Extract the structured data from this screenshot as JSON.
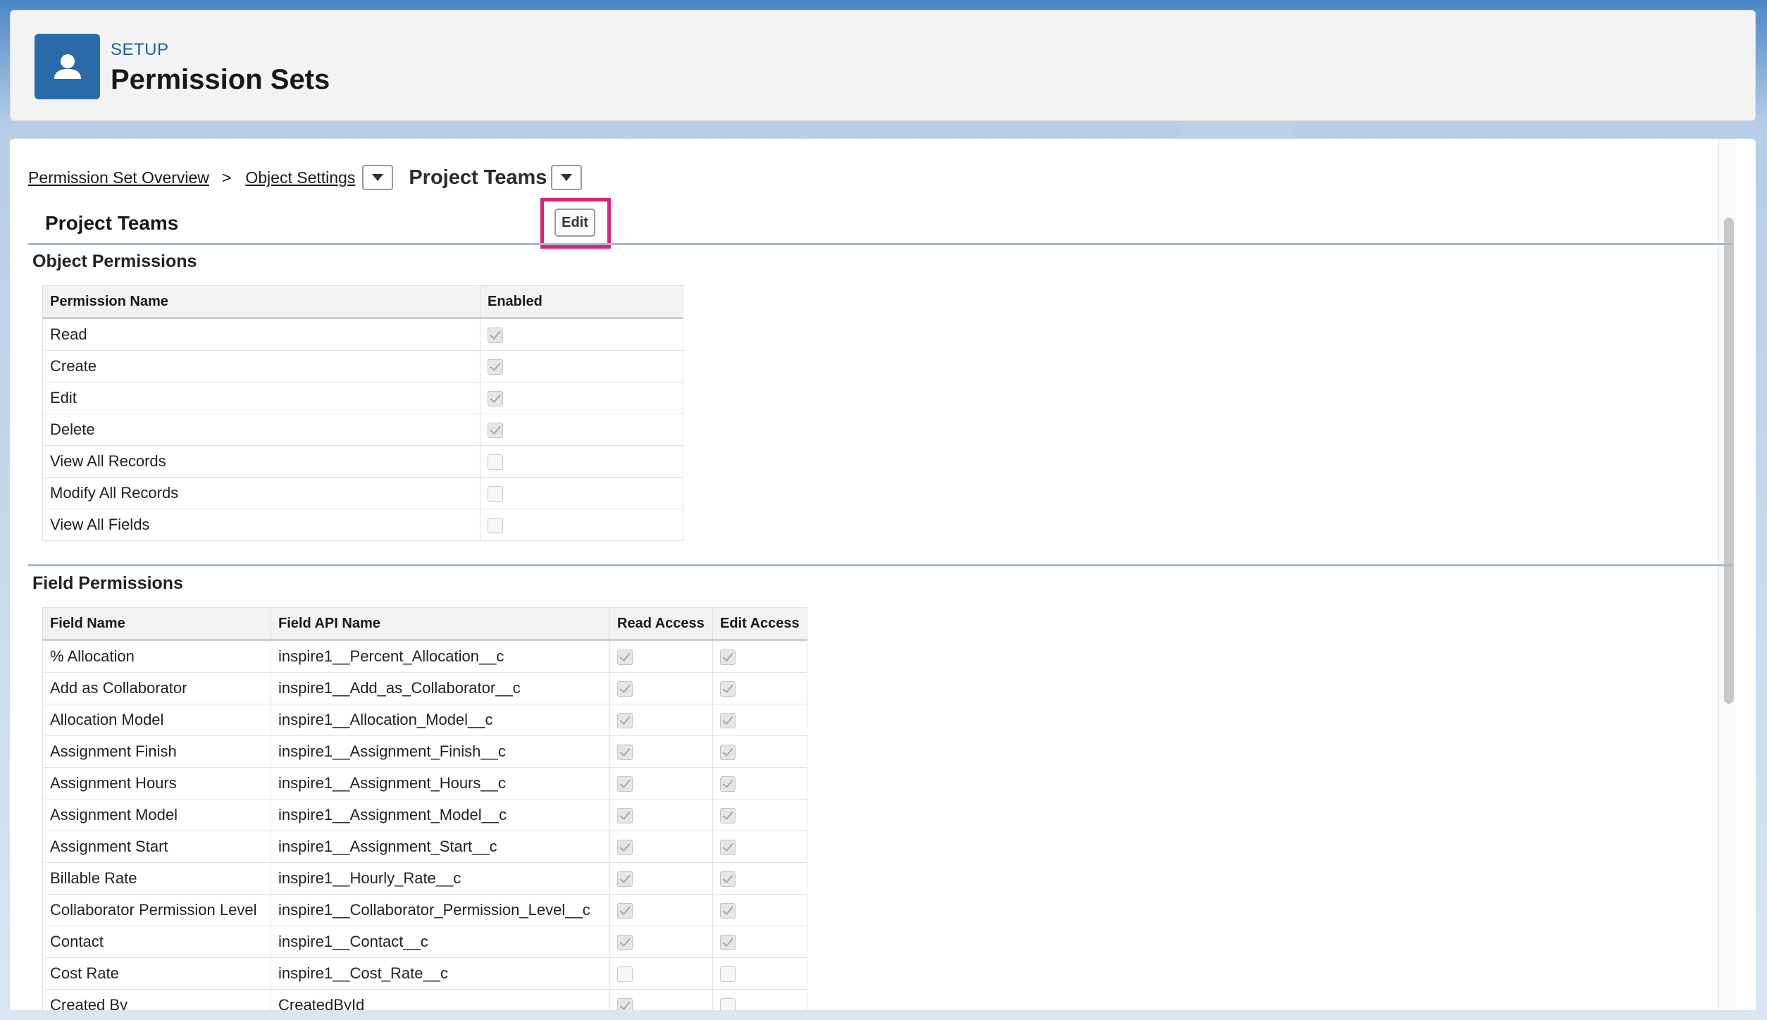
{
  "header": {
    "label": "SETUP",
    "title": "Permission Sets"
  },
  "breadcrumb": {
    "overview": "Permission Set Overview",
    "separator": ">",
    "object_settings": "Object Settings",
    "current": "Project Teams"
  },
  "section": {
    "title": "Project Teams",
    "edit_label": "Edit"
  },
  "object_permissions": {
    "title": "Object Permissions",
    "headers": [
      "Permission Name",
      "Enabled"
    ],
    "rows": [
      {
        "name": "Read",
        "enabled": true
      },
      {
        "name": "Create",
        "enabled": true
      },
      {
        "name": "Edit",
        "enabled": true
      },
      {
        "name": "Delete",
        "enabled": true
      },
      {
        "name": "View All Records",
        "enabled": false
      },
      {
        "name": "Modify All Records",
        "enabled": false
      },
      {
        "name": "View All Fields",
        "enabled": false
      }
    ]
  },
  "field_permissions": {
    "title": "Field Permissions",
    "headers": [
      "Field Name",
      "Field API Name",
      "Read Access",
      "Edit Access"
    ],
    "rows": [
      {
        "name": "% Allocation",
        "api": "inspire1__Percent_Allocation__c",
        "read": true,
        "edit": true
      },
      {
        "name": "Add as Collaborator",
        "api": "inspire1__Add_as_Collaborator__c",
        "read": true,
        "edit": true
      },
      {
        "name": "Allocation Model",
        "api": "inspire1__Allocation_Model__c",
        "read": true,
        "edit": true
      },
      {
        "name": "Assignment Finish",
        "api": "inspire1__Assignment_Finish__c",
        "read": true,
        "edit": true
      },
      {
        "name": "Assignment Hours",
        "api": "inspire1__Assignment_Hours__c",
        "read": true,
        "edit": true
      },
      {
        "name": "Assignment Model",
        "api": "inspire1__Assignment_Model__c",
        "read": true,
        "edit": true
      },
      {
        "name": "Assignment Start",
        "api": "inspire1__Assignment_Start__c",
        "read": true,
        "edit": true
      },
      {
        "name": "Billable Rate",
        "api": "inspire1__Hourly_Rate__c",
        "read": true,
        "edit": true
      },
      {
        "name": "Collaborator Permission Level",
        "api": "inspire1__Collaborator_Permission_Level__c",
        "read": true,
        "edit": true
      },
      {
        "name": "Contact",
        "api": "inspire1__Contact__c",
        "read": true,
        "edit": true
      },
      {
        "name": "Cost Rate",
        "api": "inspire1__Cost_Rate__c",
        "read": false,
        "edit": false
      },
      {
        "name": "Created By",
        "api": "CreatedById",
        "read": true,
        "edit": false
      }
    ]
  },
  "colors": {
    "highlight": "#e0207a",
    "brand": "#2a6aa9"
  },
  "icons": {
    "header": "user-icon",
    "dropdown": "chevron-down-icon"
  }
}
